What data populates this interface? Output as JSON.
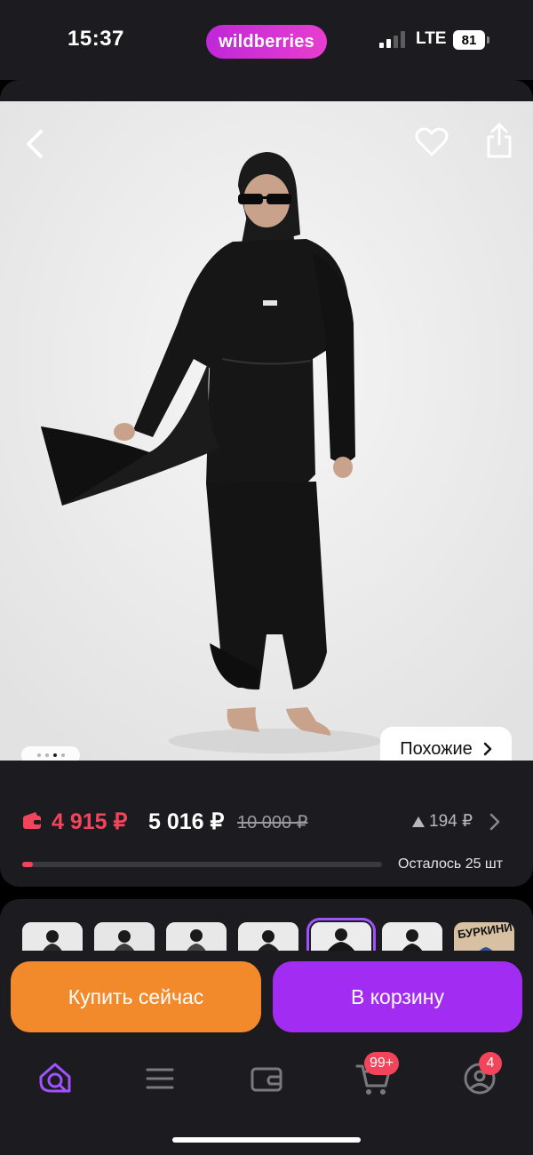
{
  "status_bar": {
    "time": "15:37",
    "brand": "wildberries",
    "network": "LTE",
    "battery": "81"
  },
  "product": {
    "similar_label": "Похожие",
    "gallery_dots": 4,
    "gallery_active_dot": 3
  },
  "pricing": {
    "wallet_price": "4 915 ₽",
    "price": "5 016 ₽",
    "old_price": "10 000 ₽",
    "price_change": "194 ₽",
    "stock_text": "Осталось 25 шт",
    "stock_fraction": 0.03
  },
  "thumbnails": {
    "count": 7,
    "selected_index": 4,
    "last_label": "БУРКИНИ"
  },
  "actions": {
    "buy_now": "Купить сейчас",
    "add_to_cart": "В корзину"
  },
  "bottom_nav": {
    "cart_badge": "99+",
    "profile_badge": "4"
  },
  "colors": {
    "accent_purple": "#a32cf2",
    "buy_orange": "#f28a2c",
    "price_red": "#f2455c",
    "brand_gradient_start": "#c027d9",
    "brand_gradient_end": "#e83ecf"
  }
}
